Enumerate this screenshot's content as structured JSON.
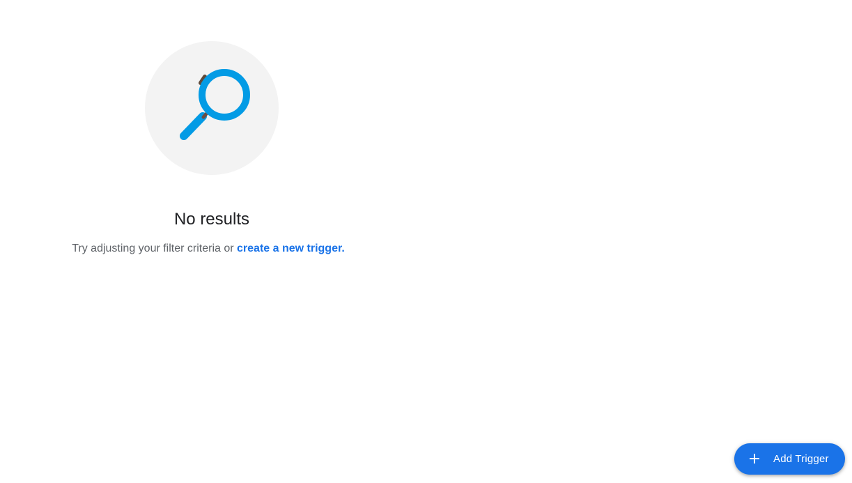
{
  "empty_state": {
    "icon": "magnifying-glass-icon",
    "title": "No results",
    "message_prefix": "Try adjusting your filter criteria or ",
    "link_text": "create a new trigger."
  },
  "fab": {
    "icon": "plus-icon",
    "label": "Add Trigger"
  },
  "colors": {
    "accent": "#1a73e8",
    "illustration_bg": "#f3f3f3",
    "magnifier": "#039be5"
  }
}
